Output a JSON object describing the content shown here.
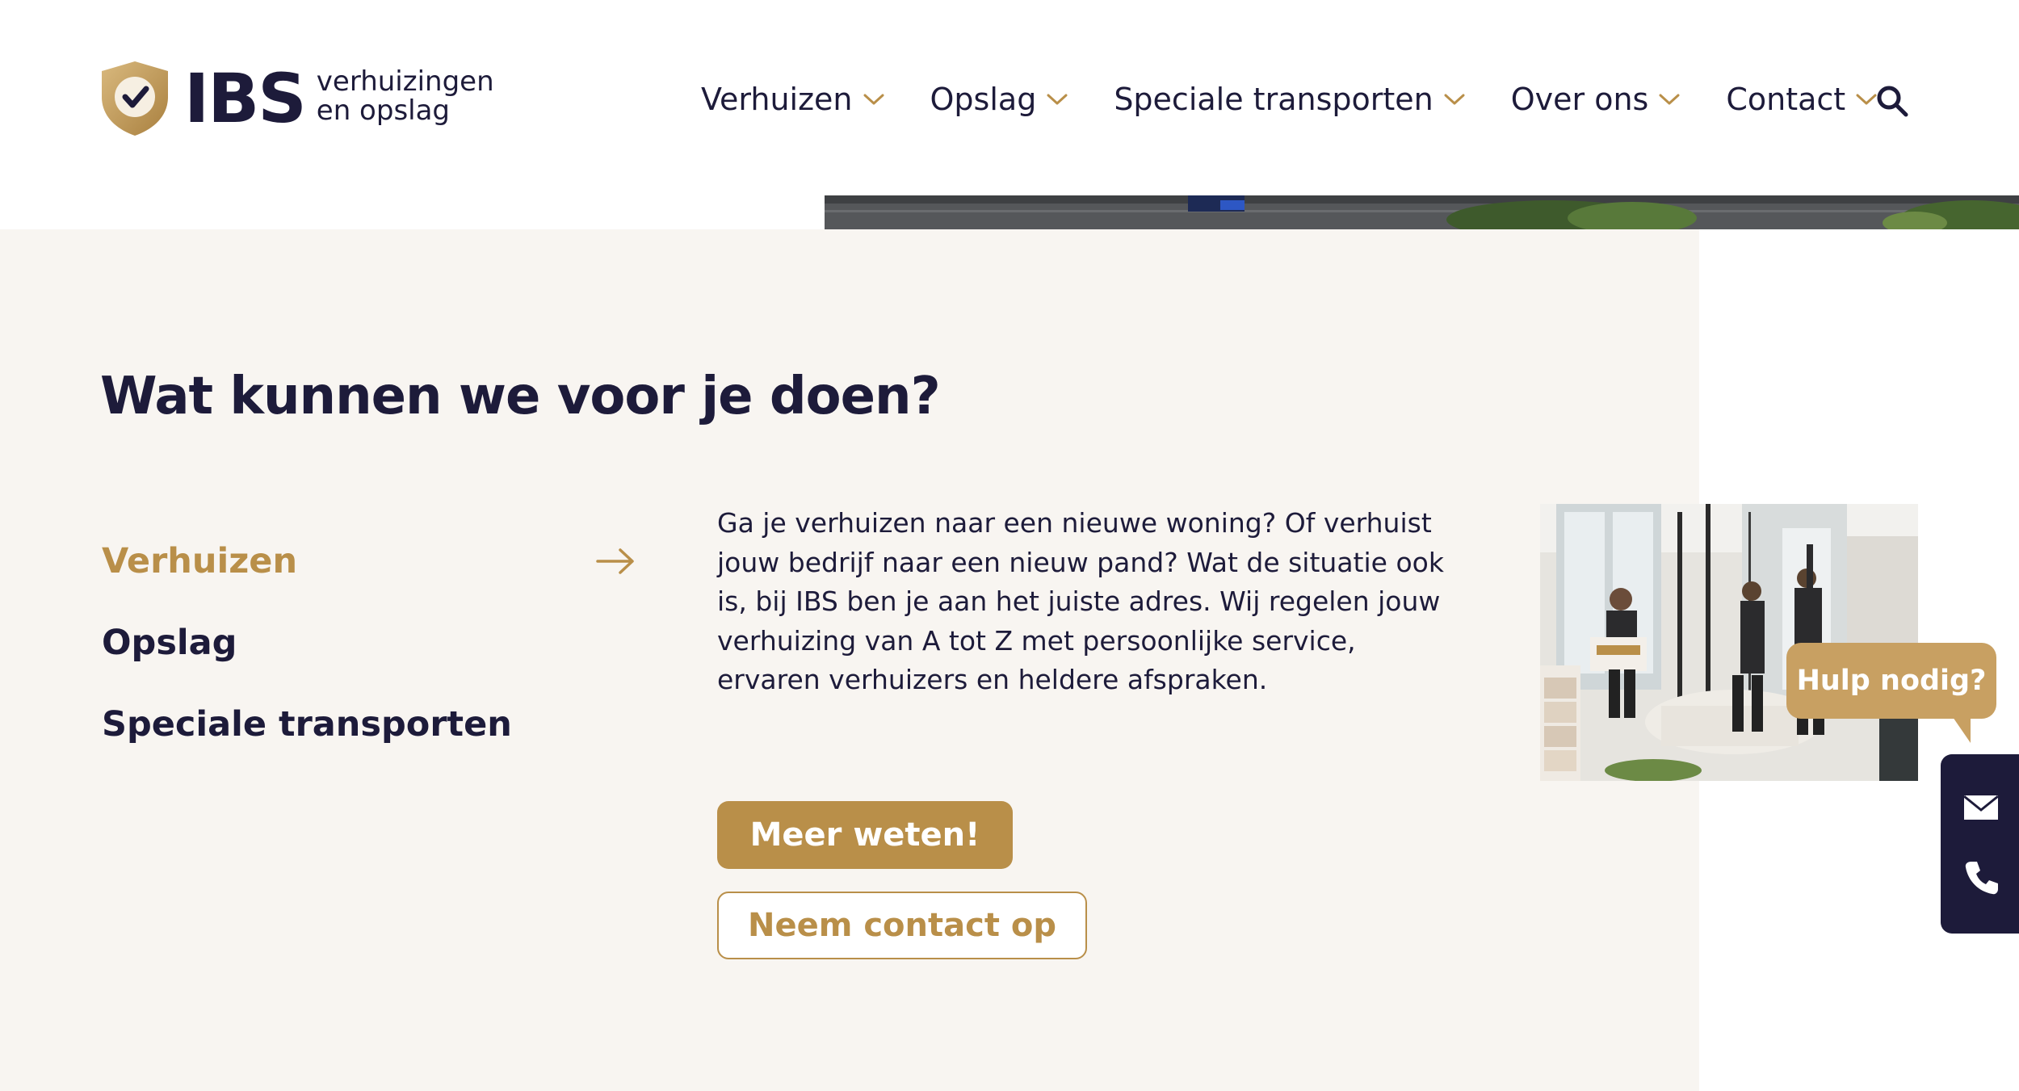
{
  "brand": {
    "name": "IBS",
    "tagline_line1": "verhuizingen",
    "tagline_line2": "en opslag",
    "gold": "#b98f49",
    "navy": "#1d1b3a"
  },
  "nav": {
    "items": [
      {
        "label": "Verhuizen",
        "icon": "chevron-down-icon"
      },
      {
        "label": "Opslag",
        "icon": "chevron-down-icon"
      },
      {
        "label": "Speciale transporten",
        "icon": "chevron-down-icon"
      },
      {
        "label": "Over ons",
        "icon": "chevron-down-icon"
      },
      {
        "label": "Contact",
        "icon": "chevron-down-icon"
      }
    ],
    "search_icon": "search-icon"
  },
  "section": {
    "title": "Wat kunnen we voor je doen?",
    "background": "#f8f5f1",
    "services": [
      {
        "label": "Verhuizen",
        "active": true,
        "icon": "arrow-right-icon"
      },
      {
        "label": "Opslag",
        "active": false
      },
      {
        "label": "Speciale transporten",
        "active": false
      }
    ],
    "description": "Ga je verhuizen naar een nieuwe woning? Of verhuist jouw bedrijf naar een nieuw pand? Wat de situatie ook is, bij IBS ben je aan het juiste adres. Wij regelen jouw verhuizing van A tot Z met persoonlijke service, ervaren verhuizers en heldere afspraken.",
    "primary_button": "Meer weten!",
    "secondary_button": "Neem contact op"
  },
  "widgets": {
    "help_label": "Hulp nodig?",
    "help_color": "#c8a062",
    "side_icons": [
      "mail-icon",
      "phone-icon"
    ]
  }
}
